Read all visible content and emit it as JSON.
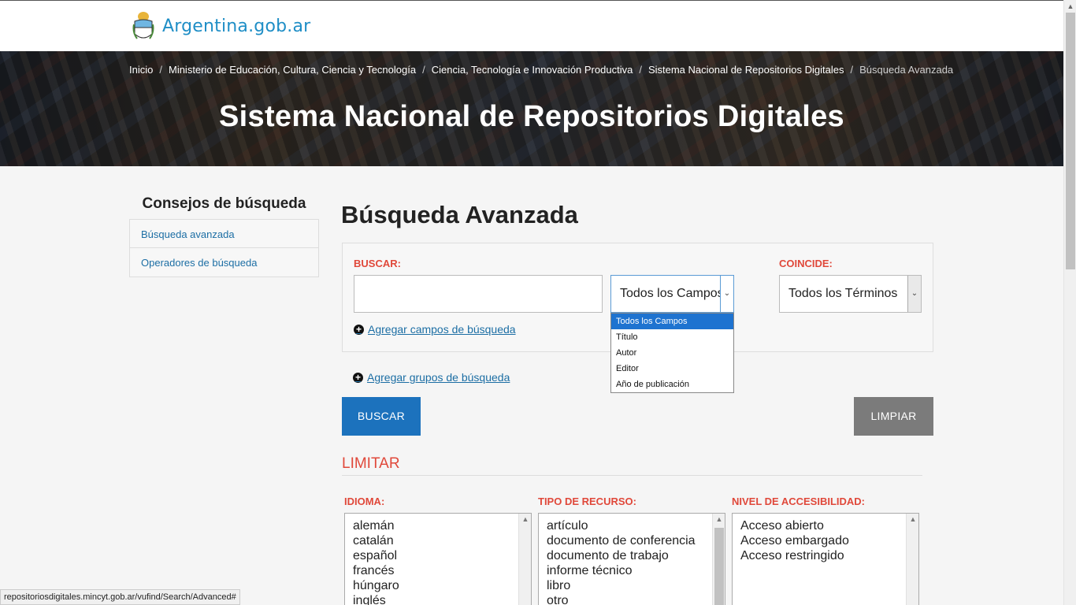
{
  "brand": {
    "logo_text": "Argentina.gob.ar"
  },
  "breadcrumb": {
    "items": [
      "Inicio",
      "Ministerio de Educación, Cultura, Ciencia y Tecnología",
      "Ciencia, Tecnología e Innovación Productiva",
      "Sistema Nacional de Repositorios Digitales"
    ],
    "current": "Búsqueda Avanzada"
  },
  "hero": {
    "title": "Sistema Nacional de Repositorios Digitales"
  },
  "sidebar": {
    "heading": "Consejos de búsqueda",
    "items": [
      "Búsqueda avanzada",
      "Operadores de búsqueda"
    ]
  },
  "main": {
    "title": "Búsqueda Avanzada",
    "buscar_label": "BUSCAR:",
    "search_value": "",
    "field_select": {
      "value": "Todos los Campos",
      "options": [
        "Todos los Campos",
        "Título",
        "Autor",
        "Editor",
        "Año de publicación"
      ]
    },
    "coincide_label": "COINCIDE:",
    "coincide_value": "Todos los Términos",
    "add_fields": "Agregar campos de búsqueda",
    "add_groups": "Agregar grupos de búsqueda",
    "buscar_button": "BUSCAR",
    "limpiar_button": "LIMPIAR",
    "limitar_heading": "LIMITAR",
    "idioma": {
      "label": "IDIOMA:",
      "options": [
        "alemán",
        "catalán",
        "español",
        "francés",
        "húngaro",
        "inglés"
      ]
    },
    "tipo": {
      "label": "TIPO DE RECURSO:",
      "options": [
        "artículo",
        "documento de conferencia",
        "documento de trabajo",
        "informe técnico",
        "libro",
        "otro"
      ]
    },
    "nivel": {
      "label": "NIVEL DE ACCESIBILIDAD:",
      "options": [
        "Acceso abierto",
        "Acceso embargado",
        "Acceso restringido"
      ]
    }
  },
  "status_bar": {
    "url": "repositoriosdigitales.mincyt.gob.ar/vufind/Search/Advanced#"
  },
  "colors": {
    "brand_blue": "#1f8ec6",
    "accent_red": "#e0483a",
    "button_blue": "#1c72bd",
    "button_gray": "#7b7b7b"
  }
}
